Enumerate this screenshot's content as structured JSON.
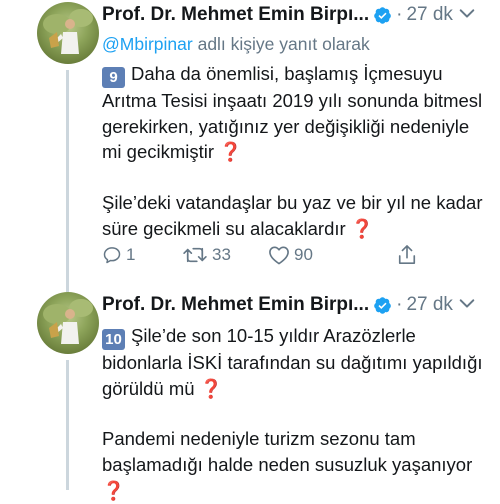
{
  "tweets": [
    {
      "author_name": "Prof. Dr. Mehmet Emin Birpı...",
      "separator": "·",
      "time": "27 dk",
      "reply_prefix": "@Mbirpinar",
      "reply_suffix": " adlı kişiye yanıt olarak",
      "keycap": "9",
      "paragraph1": "Daha da önemlisi, başlamış İçmesuyu Arıtma Tesisi inşaatı 2019 yılı sonunda bitmesl gerekirken, yatığınız yer değişikliği nedeniyle mi  gecikmiştir",
      "paragraph2": "Şile’deki vatandaşlar bu yaz ve bir yıl ne kadar süre gecikmeli su alacaklardır",
      "question_mark": "❓",
      "reply_count": "1",
      "retweet_count": "33",
      "like_count": "90"
    },
    {
      "author_name": "Prof. Dr. Mehmet Emin Birpı...",
      "separator": "·",
      "time": "27 dk",
      "keycap": "10",
      "paragraph1": "Şile’de son 10-15 yıldır Arazözlerle bidonlarla İSKİ tarafından su dağıtımı yapıldığı görüldü mü",
      "paragraph2": "Pandemi nedeniyle turizm sezonu tam başlamadığı halde neden susuzluk yaşanıyor",
      "question_mark": "❓"
    }
  ],
  "colors": {
    "link": "#1da1f2",
    "muted": "#657786",
    "keycap": "#5d7fb5",
    "question": "#d0021b"
  },
  "icons": [
    "verified-badge-icon",
    "chevron-down-icon",
    "reply-icon",
    "retweet-icon",
    "like-icon",
    "share-icon"
  ]
}
